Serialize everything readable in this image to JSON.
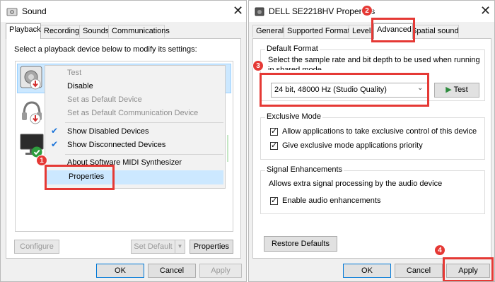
{
  "sound_window": {
    "title": "Sound",
    "tabs": [
      {
        "label": "Playback"
      },
      {
        "label": "Recording"
      },
      {
        "label": "Sounds"
      },
      {
        "label": "Communications"
      }
    ],
    "instruction": "Select a playback device below to modify its settings:",
    "context_menu": [
      {
        "label": "Test",
        "state": "disabled"
      },
      {
        "label": "Disable",
        "state": "enabled"
      },
      {
        "label": "Set as Default Device",
        "state": "disabled"
      },
      {
        "label": "Set as Default Communication Device",
        "state": "disabled"
      },
      {
        "label": "Show Disabled Devices",
        "checked": true
      },
      {
        "label": "Show Disconnected Devices",
        "checked": true
      },
      {
        "label": "About Software MIDI Synthesizer",
        "state": "enabled"
      },
      {
        "label": "Properties",
        "state": "highlighted"
      }
    ],
    "buttons": {
      "configure": "Configure",
      "set_default": "Set Default",
      "properties": "Properties",
      "ok": "OK",
      "cancel": "Cancel",
      "apply": "Apply"
    }
  },
  "props_window": {
    "title": "DELL SE2218HV Properties",
    "tabs": [
      {
        "label": "General"
      },
      {
        "label": "Supported Formats"
      },
      {
        "label": "Levels"
      },
      {
        "label": "Advanced"
      },
      {
        "label": "Spatial sound"
      }
    ],
    "default_format": {
      "title": "Default Format",
      "description": "Select the sample rate and bit depth to be used when running",
      "description_cut": "in shared mode.",
      "selected_value": "24 bit, 48000 Hz (Studio Quality)",
      "test_button": "Test"
    },
    "exclusive_mode": {
      "title": "Exclusive Mode",
      "options": [
        {
          "label": "Allow applications to take exclusive control of this device",
          "checked": true
        },
        {
          "label": "Give exclusive mode applications priority",
          "checked": true
        }
      ]
    },
    "signal_enhancements": {
      "title": "Signal Enhancements",
      "description": "Allows extra signal processing by the audio device",
      "options": [
        {
          "label": "Enable audio enhancements",
          "checked": true
        }
      ]
    },
    "restore_button": "Restore Defaults",
    "buttons": {
      "ok": "OK",
      "cancel": "Cancel",
      "apply": "Apply"
    }
  },
  "steps": [
    "1",
    "2",
    "3",
    "4"
  ],
  "colors": {
    "highlight": "#e53935",
    "menu_hover": "#cce8ff",
    "accent": "#0078d7"
  }
}
